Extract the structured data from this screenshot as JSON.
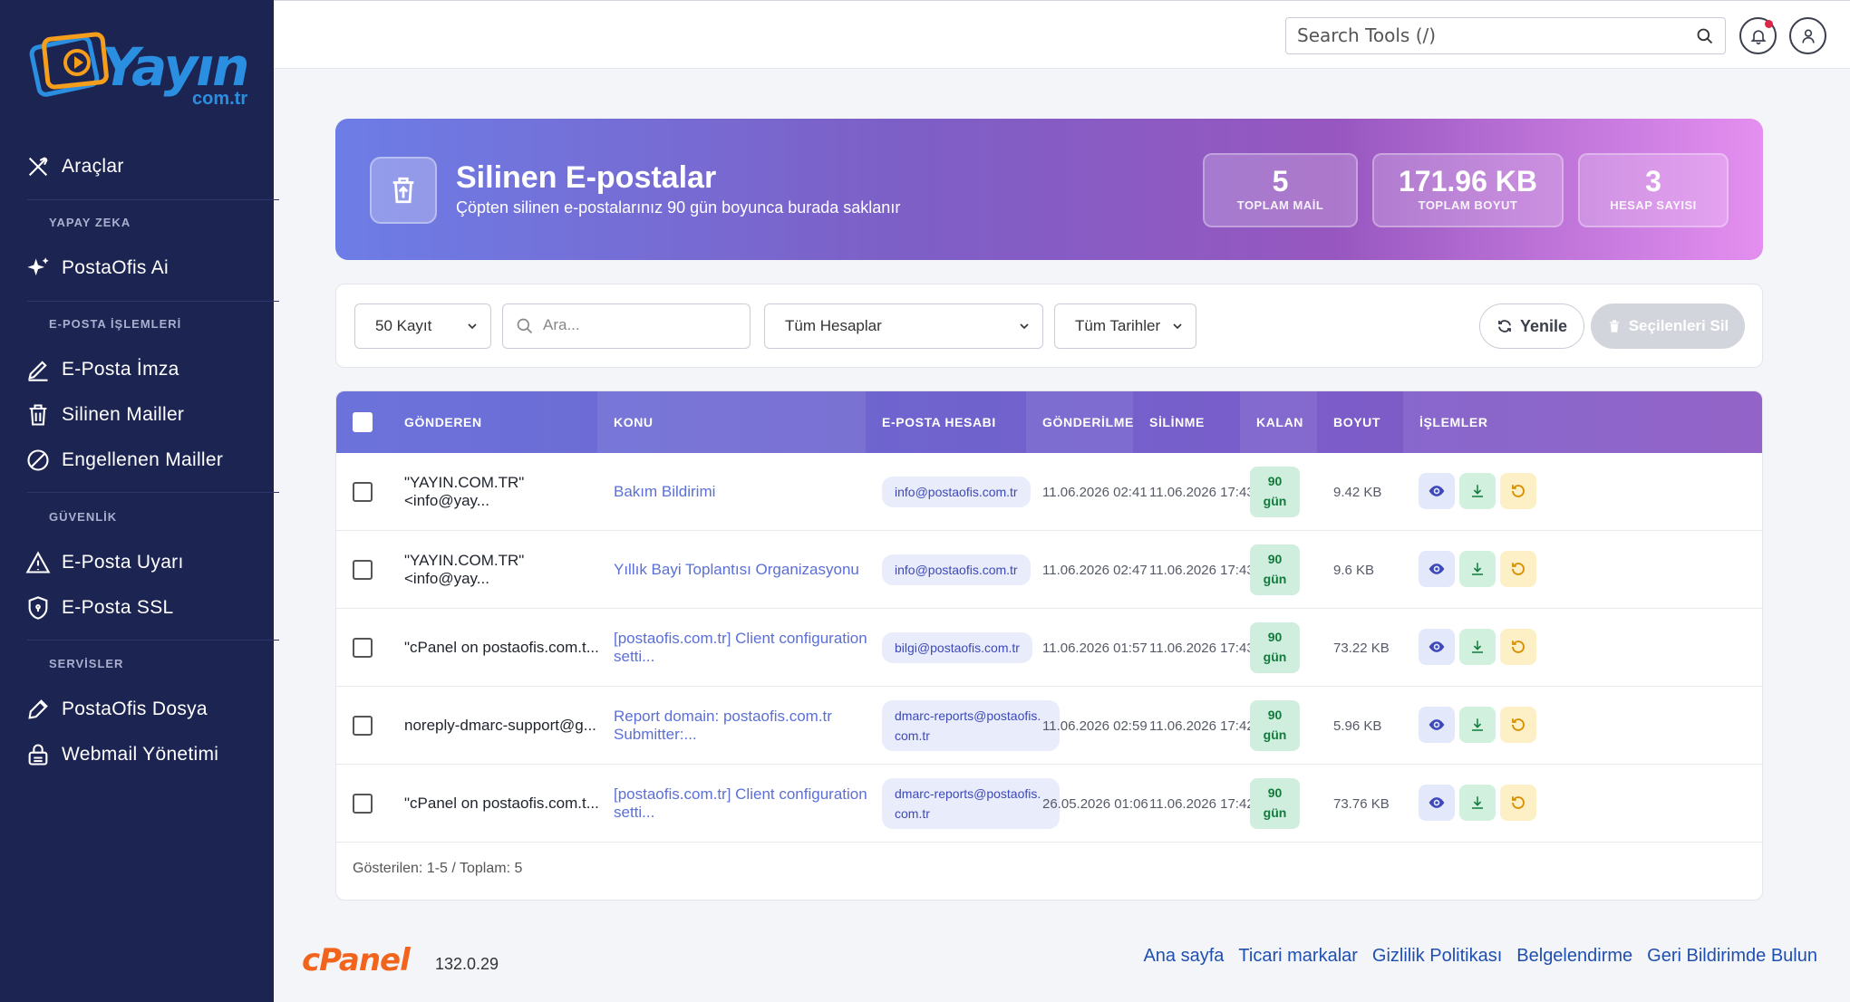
{
  "sidebar": {
    "logo_text": "Yayın",
    "logo_sub": "com.tr",
    "items": [
      {
        "label": "Araçlar",
        "icon": "tools-icon"
      },
      {
        "section": "YAPAY ZEKA"
      },
      {
        "label": "PostaOfis Ai",
        "icon": "sparkle-icon"
      },
      {
        "section": "E-POSTA İŞLEMLERİ"
      },
      {
        "label": "E-Posta İmza",
        "icon": "pen-icon"
      },
      {
        "label": "Silinen Mailler",
        "icon": "trash-icon"
      },
      {
        "label": "Engellenen Mailler",
        "icon": "block-icon"
      },
      {
        "section": "GÜVENLİK"
      },
      {
        "label": "E-Posta Uyarı",
        "icon": "warning-icon"
      },
      {
        "label": "E-Posta SSL",
        "icon": "shield-icon"
      },
      {
        "section": "SERVİSLER"
      },
      {
        "label": "PostaOfis Dosya",
        "icon": "tag-icon"
      },
      {
        "label": "Webmail Yönetimi",
        "icon": "lock-icon"
      }
    ]
  },
  "topbar": {
    "search_placeholder": "Search Tools (/)"
  },
  "hero": {
    "title": "Silinen E-postalar",
    "subtitle": "Çöpten silinen e-postalarınız 90 gün boyunca burada saklanır",
    "stats": [
      {
        "value": "5",
        "label": "TOPLAM MAİL"
      },
      {
        "value": "171.96 KB",
        "label": "TOPLAM BOYUT"
      },
      {
        "value": "3",
        "label": "HESAP SAYISI"
      }
    ]
  },
  "filters": {
    "per_page": "50 Kayıt",
    "search_placeholder": "Ara...",
    "accounts": "Tüm Hesaplar",
    "dates": "Tüm Tarihler",
    "refresh_label": "Yenile",
    "delete_selected_label": "Seçilenleri Sil"
  },
  "table": {
    "columns": [
      "GÖNDEREN",
      "KONU",
      "E-POSTA HESABI",
      "GÖNDERİLME",
      "SİLİNME",
      "KALAN",
      "BOYUT",
      "İŞLEMLER"
    ],
    "rows": [
      {
        "sender": "\"YAYIN.COM.TR\" <info@yay...",
        "subject": "Bakım Bildirimi",
        "account": "info@postaofis.com.tr",
        "sent": "11.06.2026 02:41",
        "deleted": "11.06.2026 17:43",
        "remaining": "90",
        "unit": "gün",
        "size": "9.42 KB"
      },
      {
        "sender": "\"YAYIN.COM.TR\" <info@yay...",
        "subject": "Yıllık Bayi Toplantısı Organizasyonu",
        "account": "info@postaofis.com.tr",
        "sent": "11.06.2026 02:47",
        "deleted": "11.06.2026 17:43",
        "remaining": "90",
        "unit": "gün",
        "size": "9.6 KB"
      },
      {
        "sender": "\"cPanel on postaofis.com.t...",
        "subject": "[postaofis.com.tr] Client configuration setti...",
        "account": "bilgi@postaofis.com.tr",
        "sent": "11.06.2026 01:57",
        "deleted": "11.06.2026 17:43",
        "remaining": "90",
        "unit": "gün",
        "size": "73.22 KB"
      },
      {
        "sender": "noreply-dmarc-support@g...",
        "subject": "Report domain: postaofis.com.tr Submitter:...",
        "account": "dmarc-reports@postaofis.com.tr",
        "sent": "11.06.2026 02:59",
        "deleted": "11.06.2026 17:42",
        "remaining": "90",
        "unit": "gün",
        "size": "5.96 KB"
      },
      {
        "sender": "\"cPanel on postaofis.com.t...",
        "subject": "[postaofis.com.tr] Client configuration setti...",
        "account": "dmarc-reports@postaofis.com.tr",
        "sent": "26.05.2026 01:06",
        "deleted": "11.06.2026 17:42",
        "remaining": "90",
        "unit": "gün",
        "size": "73.76 KB"
      }
    ],
    "footer": "Gösterilen: 1-5 / Toplam: 5"
  },
  "footer": {
    "brand": "cPanel",
    "version": "132.0.29",
    "links": [
      "Ana sayfa",
      "Ticari markalar",
      "Gizlilik Politikası",
      "Belgelendirme",
      "Geri Bildirimde Bulun"
    ]
  }
}
